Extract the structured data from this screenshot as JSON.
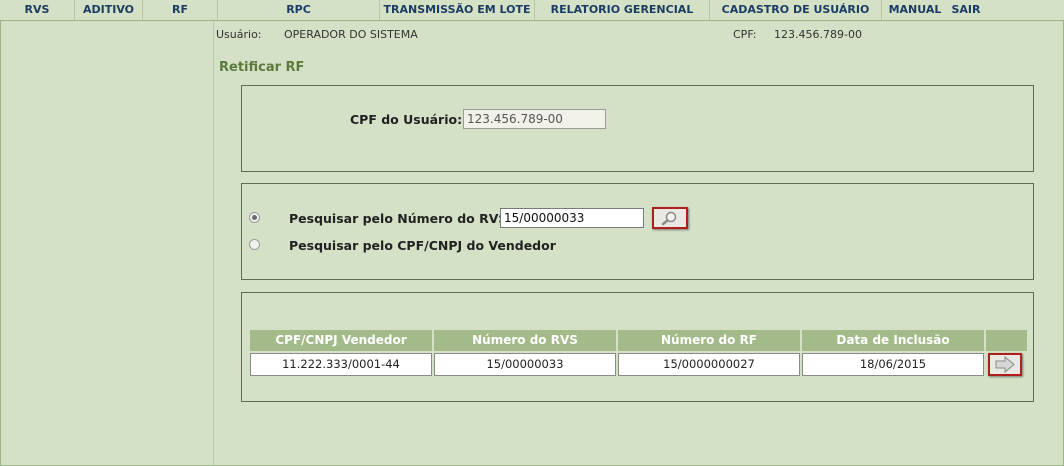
{
  "menu": {
    "items": [
      "RVS",
      "ADITIVO",
      "RF",
      "RPC",
      "TRANSMISSÃO EM LOTE",
      "RELATORIO GERENCIAL",
      "CADASTRO DE USUÁRIO",
      "MANUAL",
      "SAIR"
    ]
  },
  "info": {
    "user_label": "Usuário:",
    "user_value": "OPERADOR DO SISTEMA",
    "cpf_label": "CPF:",
    "cpf_value": "123.456.789-00"
  },
  "page": {
    "title": "Retificar RF"
  },
  "user_panel": {
    "cpf_label": "CPF do Usuário:",
    "cpf_value": "123.456.789-00"
  },
  "search_panel": {
    "option_rvs_label": "Pesquisar pelo Número do RVS",
    "option_cpf_label": "Pesquisar pelo CPF/CNPJ do Vendedor",
    "rvs_value": "15/00000033",
    "selected": "rvs"
  },
  "results": {
    "columns": [
      "CPF/CNPJ Vendedor",
      "Número do RVS",
      "Número do RF",
      "Data de Inclusão"
    ],
    "rows": [
      [
        "11.222.333/0001-44",
        "15/00000033",
        "15/0000000027",
        "18/06/2015"
      ]
    ]
  },
  "icons": {
    "search": "magnifier-icon",
    "go": "arrow-right-icon"
  },
  "colors": {
    "background": "#d4e1c6",
    "menu_text": "#1c3d63",
    "title": "#5c7a3c",
    "header_bg": "#a3bb88",
    "highlight_border": "#b01d1d"
  }
}
